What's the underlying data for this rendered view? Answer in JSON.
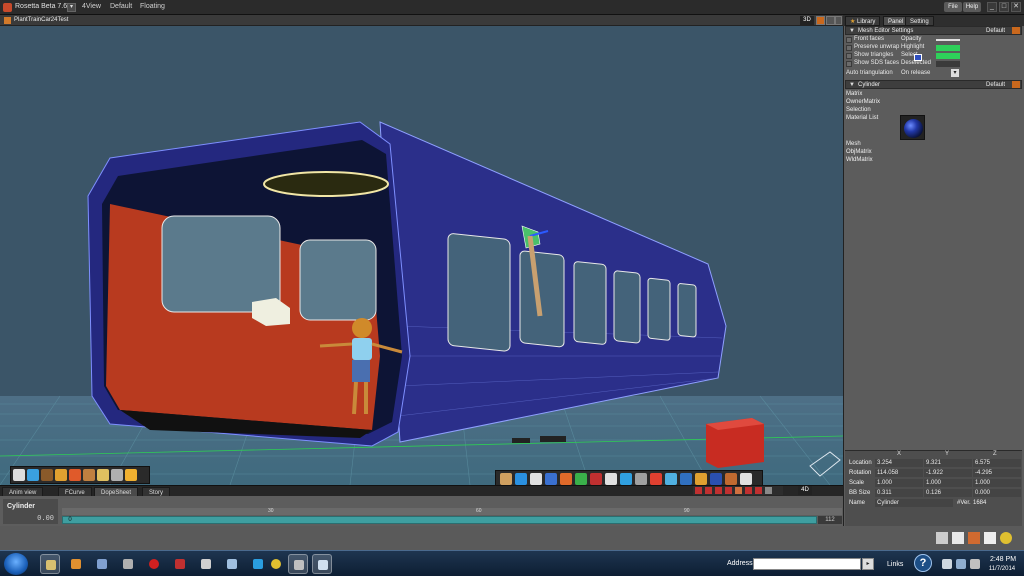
{
  "titlebar": {
    "app_title": "Rosetta Beta 7.61",
    "dropdown": "▾",
    "menus": [
      "4View",
      "Default",
      "Floating"
    ],
    "file": "File",
    "help": "Help",
    "window_controls": [
      "_",
      "□",
      "✕"
    ]
  },
  "viewport": {
    "title": "PlantTrainCar24Test",
    "mode": "3D"
  },
  "right_panel": {
    "tabs": [
      "Library",
      "Panel",
      "Setting"
    ],
    "mesh_editor": {
      "title": "Mesh Editor Settings",
      "preset": "Default",
      "options": [
        "Front faces",
        "Preserve unwrap",
        "Show triangles",
        "Show SDS faces"
      ],
      "right_labels": [
        "Opacity",
        "Highlight",
        "Select",
        "Deselected"
      ],
      "auto_triangulation_label": "Auto triangulation",
      "auto_triangulation_value": "On release"
    },
    "object": {
      "title": "Cylinder",
      "preset": "Default",
      "props": [
        "Matrix",
        "OwnerMatrix",
        "Selection",
        "Material List"
      ],
      "props2": [
        "Mesh",
        "ObjMatrix",
        "WldMatrix"
      ]
    },
    "transform": {
      "headers": [
        "X",
        "Y",
        "Z"
      ],
      "rows": [
        {
          "label": "Location",
          "x": "3.254",
          "y": "9.321",
          "z": "6.575"
        },
        {
          "label": "Rotation",
          "x": "114.058",
          "y": "-1.922",
          "z": "-4.295"
        },
        {
          "label": "Scale",
          "x": "1.000",
          "y": "1.000",
          "z": "1.000"
        },
        {
          "label": "BB Size",
          "x": "0.311",
          "y": "0.126",
          "z": "0.000"
        }
      ],
      "name_label": "Name",
      "name_value": "Cylinder",
      "ver_label": "#Ver.",
      "ver_value": "1684"
    },
    "colors": {
      "opacity": "#e0e0e0",
      "highlight": "#2ed05a",
      "select": "#2ed05a",
      "deselected": "#3a3a3a"
    }
  },
  "timeline": {
    "tabs": [
      "Anim view",
      "FCurve",
      "DopeSheet",
      "Story"
    ],
    "active_tab": "DopeSheet",
    "mode": "4D",
    "track_name": "Cylinder",
    "frame": "0.00",
    "ruler": [
      "30",
      "60",
      "90"
    ],
    "start": "0",
    "end": "112"
  },
  "taskbar": {
    "address_label": "Address",
    "address_value": "",
    "go": "▸",
    "links": "Links",
    "help": "?",
    "time": "2:48 PM",
    "date": "11/7/2014"
  }
}
